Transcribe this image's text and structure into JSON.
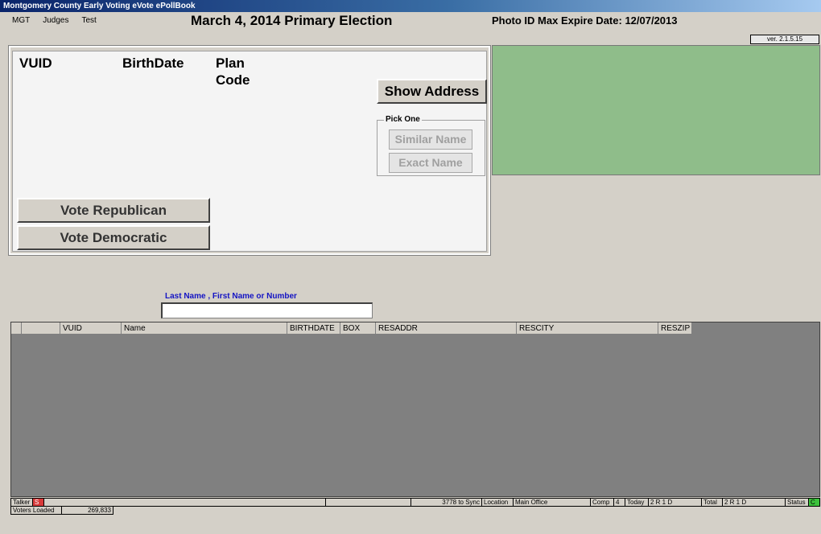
{
  "window": {
    "title": "Montgomery County Early Voting eVote ePollBook"
  },
  "menu": [
    "MGT",
    "Judges",
    "Test"
  ],
  "header": {
    "election_title": "March 4, 2014 Primary Election",
    "photo_id_label": "Photo ID Max Expire Date:",
    "photo_id_date": "12/07/2013",
    "version": "ver. 2.1.5.15"
  },
  "voter_panel": {
    "vuid_label": "VUID",
    "birthdate_label": "BirthDate",
    "plan_label": "Plan",
    "code_label": "Code",
    "show_address_button": "Show Address",
    "pick_one_label": "Pick One",
    "similar_name_button": "Similar Name",
    "exact_name_button": "Exact Name",
    "vote_republican_button": "Vote Republican",
    "vote_democratic_button": "Vote Democratic"
  },
  "search": {
    "label": "Last Name , First Name  or Number",
    "value": ""
  },
  "grid": {
    "columns": [
      "",
      "",
      "VUID",
      "Name",
      "BIRTHDATE",
      "BOX",
      "RESADDR",
      "RESCITY",
      "RESZIP"
    ]
  },
  "status": {
    "talker_label": "Talker",
    "talker_value": "S",
    "sync": "3778 to Sync",
    "location_label": "Location",
    "location_value": "Main Office",
    "comp_label": "Comp",
    "comp_value": "4",
    "today_label": "Today",
    "today_value": "2 R  1 D",
    "total_label": "Total",
    "total_value": "2 R  1 D",
    "status_label": "Status",
    "status_value": "C",
    "voters_loaded_label": "Voters Loaded",
    "voters_loaded_value": "269,833"
  },
  "colors": {
    "panel_green": "#8fbd8a",
    "talker_red": "#d83a3a",
    "status_green": "#3cc23c",
    "search_label_blue": "#1313c4"
  }
}
